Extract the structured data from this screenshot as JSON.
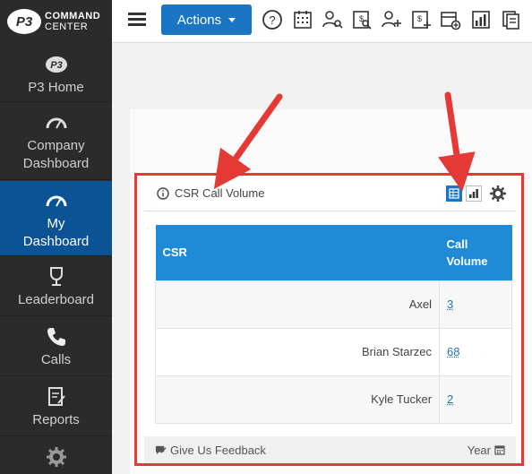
{
  "brand": {
    "mark": "P3",
    "line1": "COMMAND",
    "line2": "CENTER"
  },
  "sidebar": {
    "items": [
      {
        "label": "P3 Home",
        "icon": "p3-logo-icon"
      },
      {
        "label": "Company Dashboard",
        "icon": "speedometer-icon"
      },
      {
        "label": "My Dashboard",
        "icon": "speedometer-icon",
        "active": true
      },
      {
        "label": "Leaderboard",
        "icon": "trophy-icon"
      },
      {
        "label": "Calls",
        "icon": "phone-icon"
      },
      {
        "label": "Reports",
        "icon": "report-icon"
      },
      {
        "label": "",
        "icon": "gear-icon"
      }
    ]
  },
  "topbar": {
    "actions_label": "Actions",
    "icons": [
      "help-icon",
      "calendar-grid-icon",
      "user-search-icon",
      "sale-search-icon",
      "add-user-icon",
      "add-sale-icon",
      "add-calendar-icon",
      "bar-chart-icon",
      "documents-icon"
    ]
  },
  "widget": {
    "title": "CSR Call Volume",
    "columns": [
      "CSR",
      "Call Volume"
    ],
    "rows": [
      {
        "name": "Axel",
        "value": "3"
      },
      {
        "name": "Brian Starzec",
        "value": "68"
      },
      {
        "name": "Kyle Tucker",
        "value": "2"
      }
    ],
    "feedback_label": "Give Us Feedback",
    "period_label": "Year"
  },
  "colors": {
    "accent": "#1a75c2",
    "header": "#1f8ad6",
    "sidebar": "#2b2b2b",
    "active": "#0b5394",
    "annotation": "#e53935"
  }
}
